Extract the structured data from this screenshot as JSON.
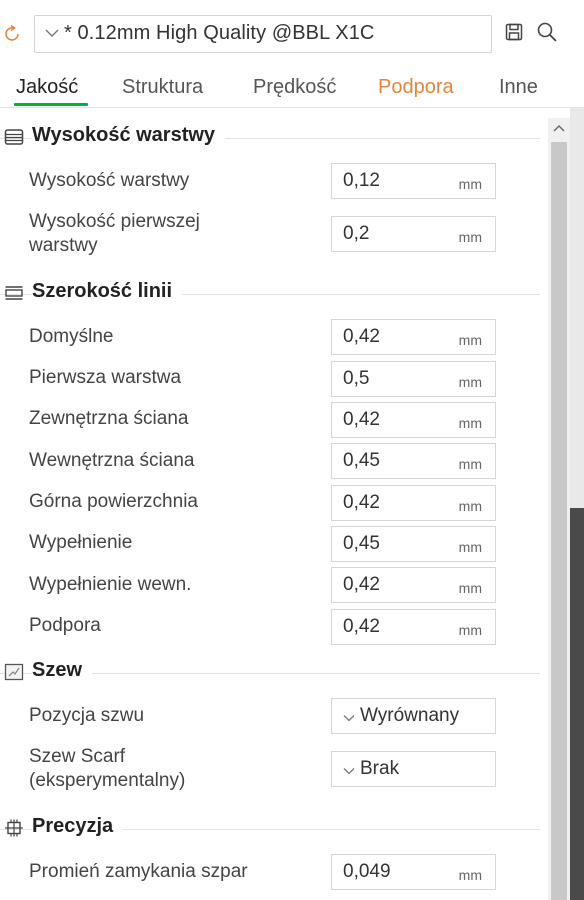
{
  "preset": {
    "name": "* 0.12mm High Quality @BBL X1C",
    "icons": {
      "reset": "reset-arrow-icon",
      "save": "save-icon",
      "search": "search-icon"
    },
    "reset_color": "#e8833a"
  },
  "tabs": [
    {
      "label": "Jakość",
      "active": true
    },
    {
      "label": "Struktura"
    },
    {
      "label": "Prędkość"
    },
    {
      "label": "Podpora",
      "color": "#e8833a"
    },
    {
      "label": "Inne"
    }
  ],
  "accent_color": "#00ae42",
  "sections": {
    "layer_height": {
      "title": "Wysokość warstwy",
      "icon": "layers-icon",
      "rows": [
        {
          "label": "Wysokość warstwy",
          "value": "0,12",
          "unit": "mm"
        },
        {
          "label_line1": "Wysokość pierwszej",
          "label_line2": "warstwy",
          "value": "0,2",
          "unit": "mm"
        }
      ]
    },
    "line_width": {
      "title": "Szerokość linii",
      "icon": "line-width-icon",
      "rows": [
        {
          "label": "Domyślne",
          "value": "0,42",
          "unit": "mm"
        },
        {
          "label": "Pierwsza warstwa",
          "value": "0,5",
          "unit": "mm"
        },
        {
          "label": "Zewnętrzna ściana",
          "value": "0,42",
          "unit": "mm"
        },
        {
          "label": "Wewnętrzna ściana",
          "value": "0,45",
          "unit": "mm"
        },
        {
          "label": "Górna powierzchnia",
          "value": "0,42",
          "unit": "mm"
        },
        {
          "label": "Wypełnienie",
          "value": "0,45",
          "unit": "mm"
        },
        {
          "label": "Wypełnienie wewn.",
          "value": "0,42",
          "unit": "mm"
        },
        {
          "label": "Podpora",
          "value": "0,42",
          "unit": "mm"
        }
      ]
    },
    "seam": {
      "title": "Szew",
      "icon": "seam-icon",
      "rows": [
        {
          "label": "Pozycja szwu",
          "value": "Wyrównany"
        },
        {
          "label_line1": "Szew Scarf",
          "label_line2": "(eksperymentalny)",
          "value": "Brak"
        }
      ]
    },
    "precision": {
      "title": "Precyzja",
      "icon": "precision-icon",
      "rows": [
        {
          "label": "Promień zamykania szpar",
          "value": "0,049",
          "unit": "mm"
        }
      ]
    }
  }
}
